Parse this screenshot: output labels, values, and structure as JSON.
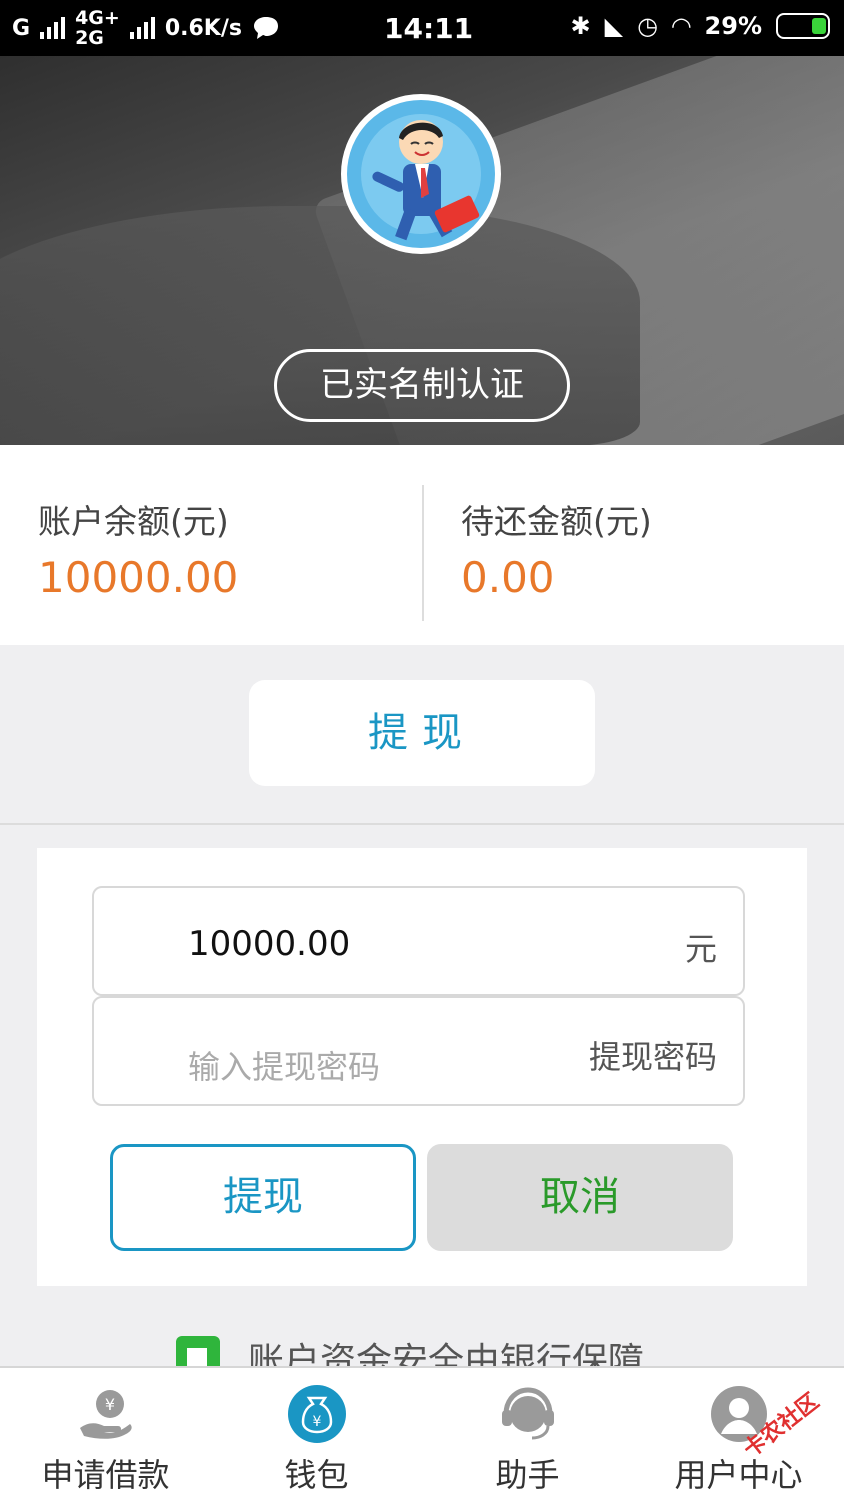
{
  "status_bar": {
    "carrier": "G",
    "net_top": "4G+",
    "net_bottom": "2G",
    "speed": "0.6K/s",
    "time": "14:11",
    "battery": "29%"
  },
  "header": {
    "auth_badge": "已实名制认证"
  },
  "balances": {
    "account_label": "账户余额(元)",
    "account_value": "10000.00",
    "due_label": "待还金额(元)",
    "due_value": "0.00"
  },
  "withdraw": {
    "title_button": "提现",
    "amount_value": "10000.00",
    "amount_unit": "元",
    "password_placeholder": "输入提现密码",
    "password_label": "提现密码",
    "confirm_label": "提现",
    "cancel_label": "取消"
  },
  "security_note": "账户资金安全由银行保障",
  "bottom_nav": {
    "items": [
      {
        "label": "申请借款",
        "icon": "loan-hand-icon"
      },
      {
        "label": "钱包",
        "icon": "wallet-bag-icon"
      },
      {
        "label": "助手",
        "icon": "assistant-headset-icon"
      },
      {
        "label": "用户中心",
        "icon": "user-icon"
      }
    ]
  },
  "watermark": "卡农社区",
  "colors": {
    "accent_blue": "#1a96c4",
    "amount_orange": "#e8782a",
    "cancel_green": "#2a9a2a",
    "shield_green": "#2fb53c"
  }
}
